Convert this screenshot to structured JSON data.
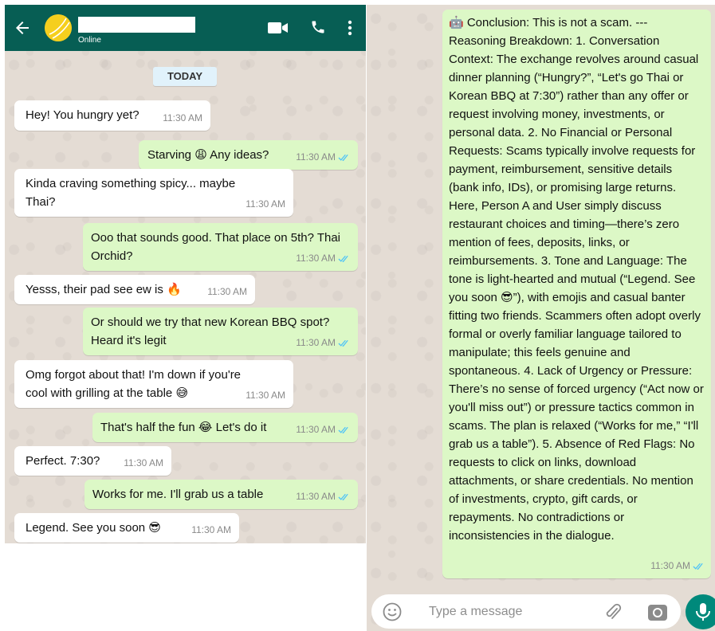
{
  "contact": {
    "status": "Online"
  },
  "chat": {
    "date_label": "TODAY",
    "messages": [
      {
        "text": "Hey! You hungry yet?",
        "time": "11:30 AM"
      },
      {
        "text": "Starving 😩 Any ideas?",
        "time": "11:30 AM"
      },
      {
        "text": "Kinda craving something spicy... maybe Thai?",
        "time": "11:30 AM"
      },
      {
        "text": "Ooo that sounds good. That place on 5th? Thai Orchid?",
        "time": "11:30 AM"
      },
      {
        "text": "Yesss, their pad see ew is 🔥",
        "time": "11:30 AM"
      },
      {
        "text": "Or should we try that new Korean BBQ spot? Heard it's legit",
        "time": "11:30 AM"
      },
      {
        "text": "Omg forgot about that! I'm down if you're cool with grilling at the table 😅",
        "time": "11:30 AM"
      },
      {
        "text": "That's half the fun 😂 Let's do it",
        "time": "11:30 AM"
      },
      {
        "text": "Perfect. 7:30?",
        "time": "11:30 AM"
      },
      {
        "text": "Works for me. I'll grab us a table",
        "time": "11:30 AM"
      },
      {
        "text": "Legend. See you soon 😎",
        "time": "11:30 AM"
      }
    ]
  },
  "analysis": {
    "text": "🤖 Conclusion: This is not a scam. --- Reasoning Breakdown: 1. Conversation Context: The exchange revolves around casual dinner planning (“Hungry?”, “Let's go Thai or Korean BBQ at 7:30”) rather than any offer or request involving money, investments, or personal data. 2. No Financial or Personal Requests: Scams typically involve requests for payment, reimbursement, sensitive details (bank info, IDs), or promising large returns. Here, Person A and User simply discuss restaurant choices and timing—there’s zero mention of fees, deposits, links, or reimbursements. 3. Tone and Language: The tone is light-hearted and mutual (“Legend. See you soon 😎”), with emojis and casual banter fitting two friends. Scammers often adopt overly formal or overly familiar language tailored to manipulate; this feels genuine and spontaneous. 4. Lack of Urgency or Pressure: There’s no sense of forced urgency (“Act now or you'll miss out”) or pressure tactics common in scams. The plan is relaxed (“Works for me,” “I'll grab us a table”). 5. Absence of Red Flags: No requests to click on links, download attachments, or share credentials. No mention of investments, crypto, gift cards, or repayments. No contradictions or inconsistencies in the dialogue.",
    "time": "11:30 AM"
  },
  "composer": {
    "placeholder": "Type a message"
  },
  "colors": {
    "header": "#075e54",
    "incoming": "#ffffff",
    "outgoing": "#dcf8c6",
    "chat_bg": "#e4dcd4",
    "read_tick": "#4fc3f7",
    "mic": "#00897b"
  },
  "icons": [
    "back-arrow-icon",
    "avatar",
    "video-call-icon",
    "phone-icon",
    "more-options-icon",
    "emoji-icon",
    "attach-icon",
    "camera-icon",
    "mic-icon",
    "read-receipt-icon"
  ]
}
